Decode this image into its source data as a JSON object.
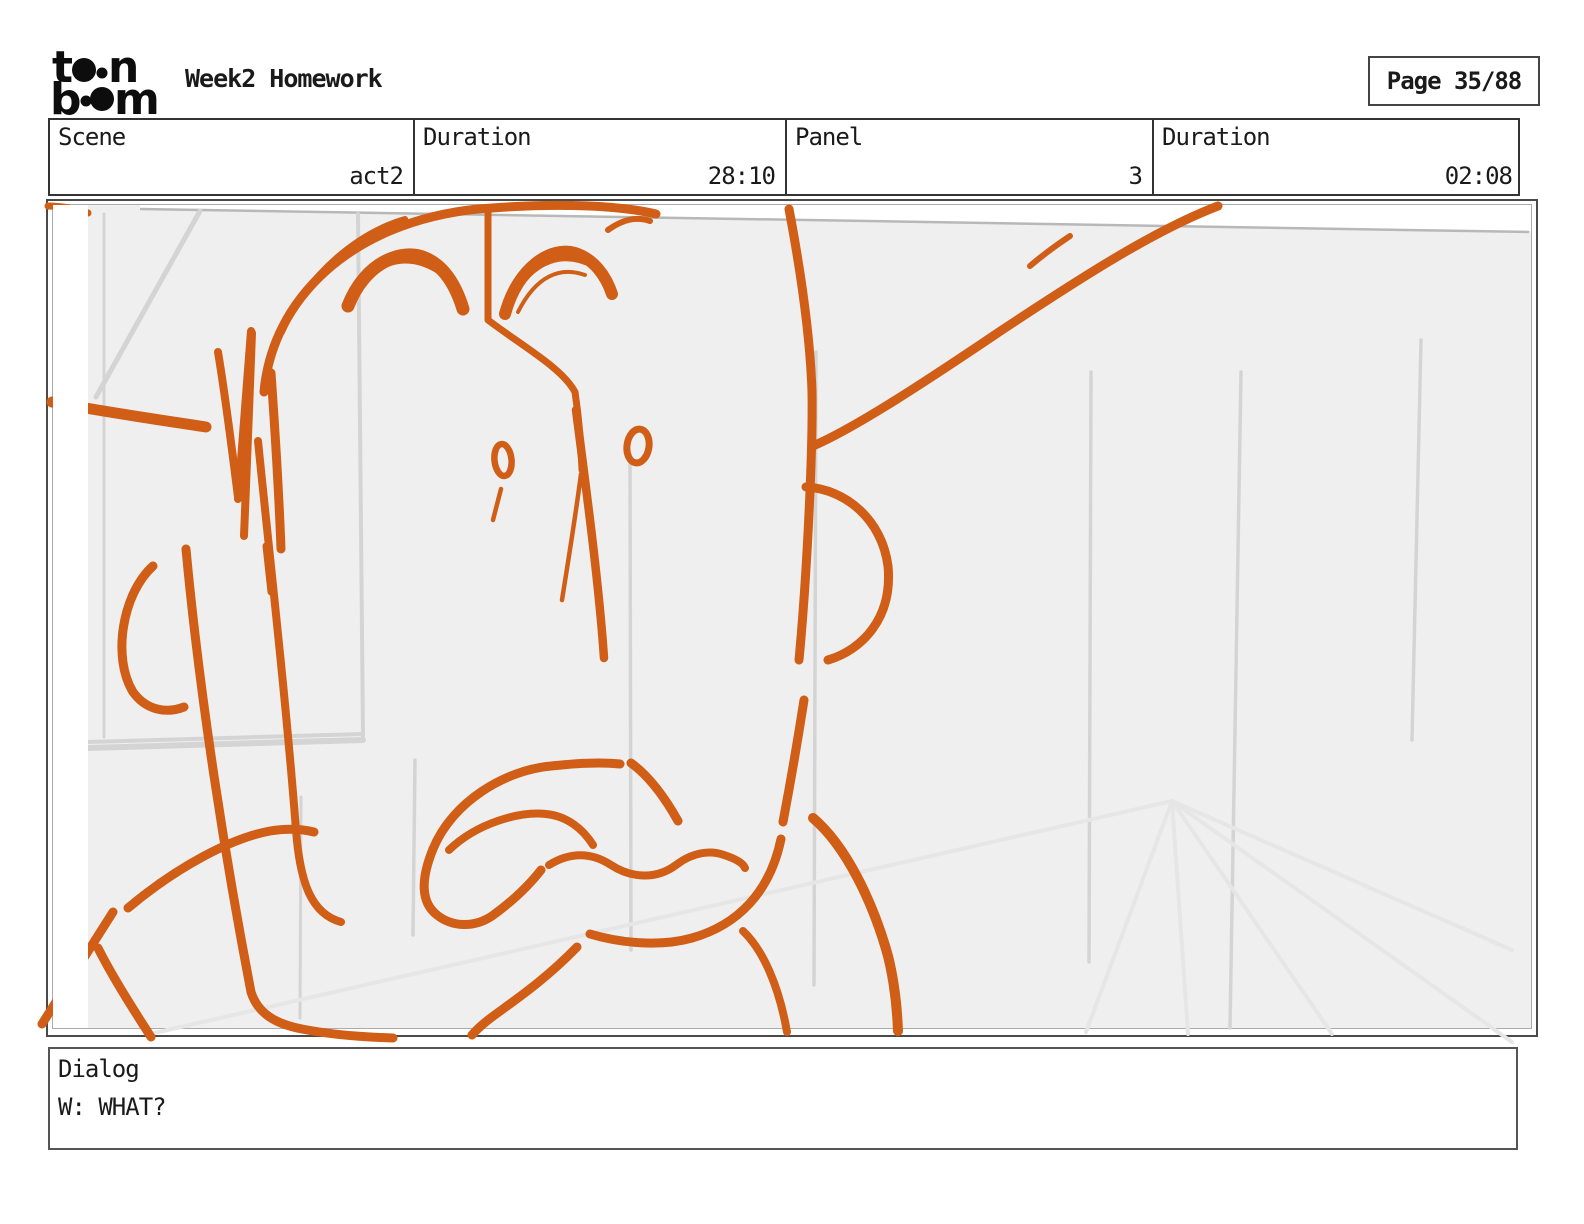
{
  "header": {
    "logo": {
      "line1": "to•n",
      "line2": "b••m",
      "brand": "Toon Boom"
    },
    "title": "Week2 Homework",
    "page_label": "Page 35/88"
  },
  "info_table": {
    "cells": [
      {
        "label": "Scene",
        "value": "act2"
      },
      {
        "label": "Duration",
        "value": "28:10"
      },
      {
        "label": "Panel",
        "value": "3"
      },
      {
        "label": "Duration",
        "value": "02:08"
      }
    ]
  },
  "storyboard_panel": {
    "description": "Rough orange storyboard sketch of a shocked man's face with raised eyebrows, tiny eyes, long nose and open frowning mouth with tongue; hat brim lines sweep left and upper-right; faint gray room construction lines and perspective rays in background",
    "panel_number": "3"
  },
  "dialog": {
    "label": "Dialog",
    "line": "W: WHAT?"
  },
  "colors": {
    "ink": "#d05e16",
    "wall": "#efeff0",
    "wall-line": "#d4d4d4",
    "frame-border": "#4a4a4a"
  }
}
